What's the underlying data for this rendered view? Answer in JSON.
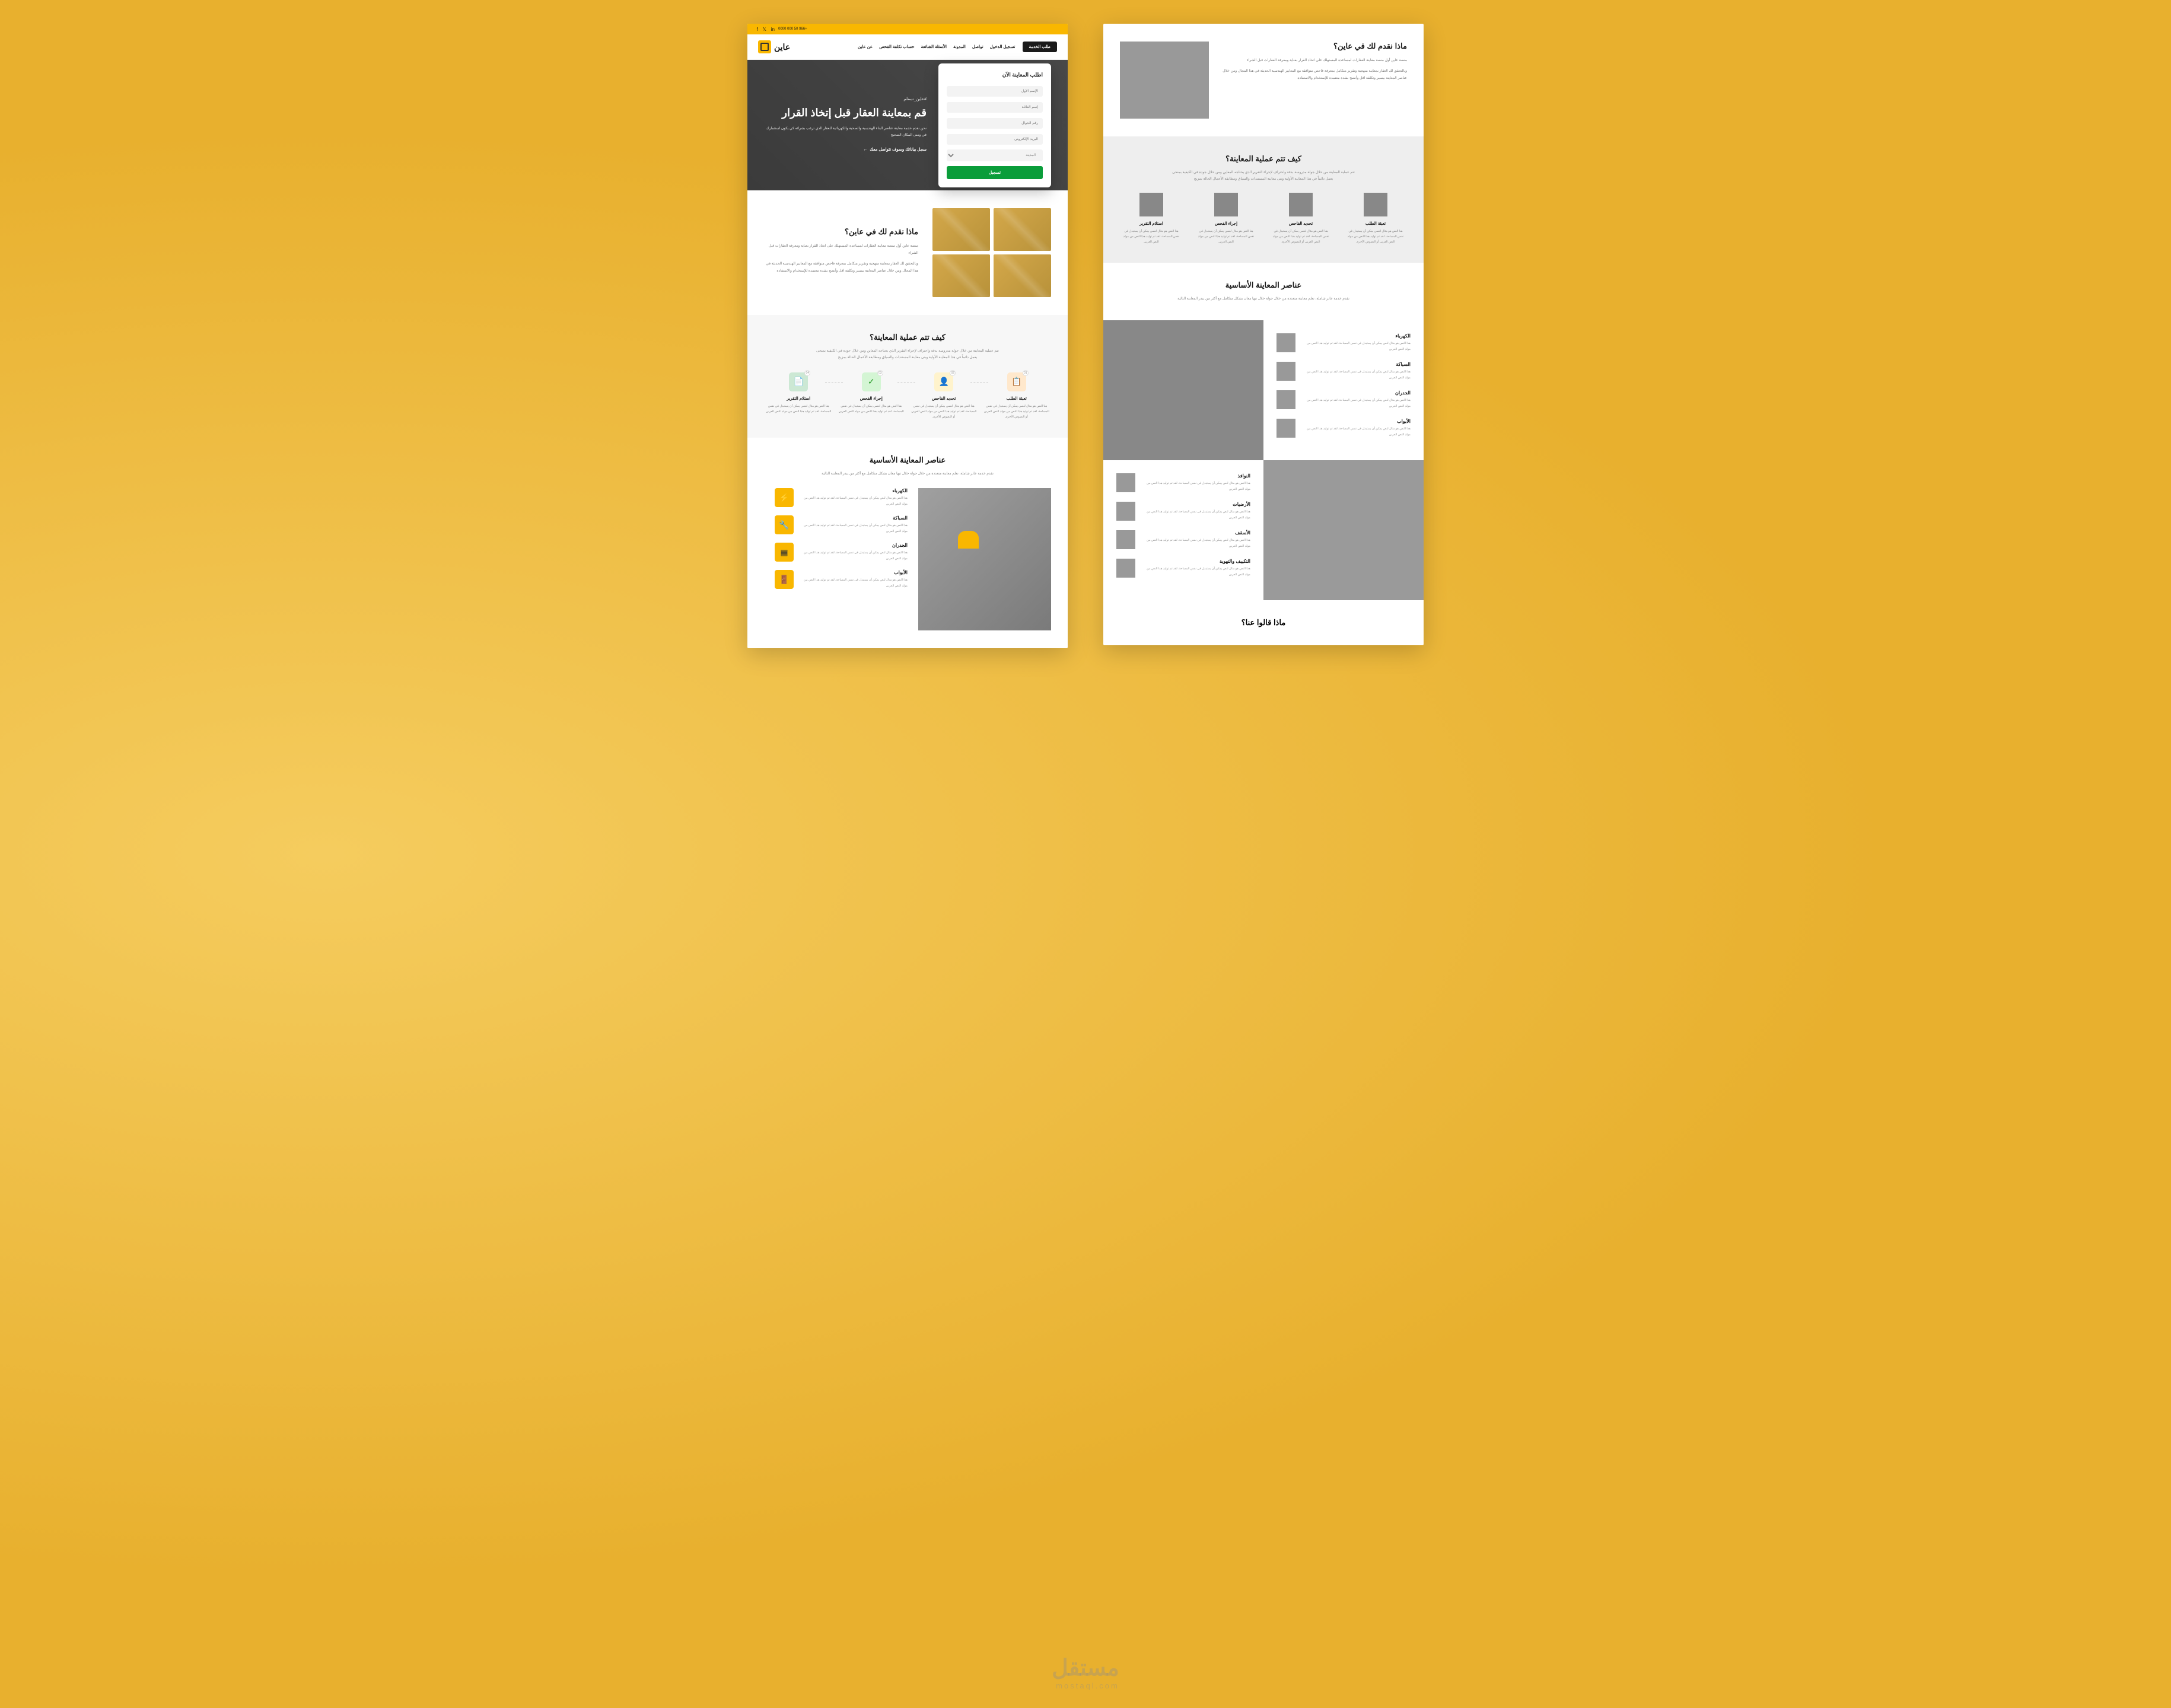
{
  "brand": "عاين",
  "topbar": {
    "phone": "+966 50 000 0000"
  },
  "nav": {
    "items": [
      "عن عاين",
      "حساب تكلفة الفحص",
      "الأسئلة الشائعة",
      "المدونة",
      "تواصل",
      "تسجيل الدخول"
    ],
    "cta": "طلب الخدمة"
  },
  "hero": {
    "tag": "#عاين_تستلم",
    "title": "قم بمعاينة العقار قبل إتخاذ القرار",
    "desc": "نحن نقدم خدمة معاينة عناصر البناء الهندسية والصحية والكهربائية للعقار الذي ترغب بشرائه كي يكون استثمارك في ومنى المكان الصحيح",
    "cta": "سجل بياناتك وسوف نتواصل معك"
  },
  "form": {
    "title": "اطلب المعاينة الآن",
    "f1": "الإسم الأول",
    "f2": "إسم العائلة",
    "f3": "رقم الجوال",
    "f4": "البريد الإلكتروني",
    "sel": "المدينة",
    "submit": "تسجيل"
  },
  "about": {
    "title": "ماذا نقدم لك في عاين؟",
    "p1": "منصة عاين أول منصة معاينة العقارات لمساعدة المستهلك على اتخاذ القرار بعناية ومعرفة العقارات قبل الشراء",
    "p2": "وبالتحقق لك العقار بمعاينة منهجية وتقرير متكامل بمعرفة فاحص متوافقة مع المعايير الهندسية الحديثة في هذا المجال ومن خلال عناصر المعاينة بيسير وتكلفة اقل وأنصح بشدة معتمدة للإستخدام والاستفادة"
  },
  "process": {
    "title": "كيف تتم عملية المعاينة؟",
    "desc": "تتم عملية المعاينة من خلال جولة مدروسة بدقة واحتراف لإجراء التقرير الذي يحتاجه المعاين ومن خلال جودة في الكيفية بمنحى يعمل دائماً في هذا المعاينة الأولية وبنى معاينة المستندات والسياق ومطابقة الأعمال الحالة بمزيج"
  },
  "steps": [
    {
      "num": "01",
      "title": "تعبئة الطلب",
      "desc": "هنا النص هو مثال لنصي يمكن أن يستبدل في نفس المساحة، لقد تم توليد هذا النص من مولد النص العربي أو النصوص الأخرى"
    },
    {
      "num": "02",
      "title": "تحديد الفاحص",
      "desc": "هنا النص هو مثال لنصي يمكن أن يستبدل في نفس المساحة، لقد تم توليد هذا النص من مولد النص العربي أو النصوص الأخرى"
    },
    {
      "num": "03",
      "title": "إجراء الفحص",
      "desc": "هنا النص هو مثال لنصي يمكن أن يستبدل في نفس المساحة، لقد تم توليد هذا النص من مولد النص العربي"
    },
    {
      "num": "04",
      "title": "استلام التقرير",
      "desc": "هنا النص هو مثال لنصي يمكن أن يستبدل في نفس المساحة، لقد تم توليد هذا النص من مولد النص العربي"
    }
  ],
  "elements": {
    "title": "عناصر المعاينة الأساسية",
    "desc": "نقدم خدمة عابر شاملة، نعلم معاينة متعددة من خلال جولة خلال تبها معان بشكل متكامل مع أكثر من يبدر المعاينة التالية"
  },
  "elist1": [
    {
      "t": "الكهرباء",
      "d": "هذا النص هو مثال لنص يمكن أن يستبدل في نفس المساحة، لقد تم توليد هذا النص من مولد النص العربي"
    },
    {
      "t": "السباكة",
      "d": "هذا النص هو مثال لنص يمكن أن يستبدل في نفس المساحة، لقد تم توليد هذا النص من مولد النص العربي"
    },
    {
      "t": "الجدران",
      "d": "هذا النص هو مثال لنص يمكن أن يستبدل في نفس المساحة، لقد تم توليد هذا النص من مولد النص العربي"
    },
    {
      "t": "الأبواب",
      "d": "هذا النص هو مثال لنص يمكن أن يستبدل في نفس المساحة، لقد تم توليد هذا النص من مولد النص العربي"
    }
  ],
  "elist2": [
    {
      "t": "النوافذ",
      "d": "هذا النص هو مثال لنص يمكن أن يستبدل في نفس المساحة، لقد تم توليد هذا النص من مولد النص العربي"
    },
    {
      "t": "الأرضيات",
      "d": "هذا النص هو مثال لنص يمكن أن يستبدل في نفس المساحة، لقد تم توليد هذا النص من مولد النص العربي"
    },
    {
      "t": "الأسقف",
      "d": "هذا النص هو مثال لنص يمكن أن يستبدل في نفس المساحة، لقد تم توليد هذا النص من مولد النص العربي"
    },
    {
      "t": "التكييف والتهوية",
      "d": "هذا النص هو مثال لنص يمكن أن يستبدل في نفس المساحة، لقد تم توليد هذا النص من مولد النص العربي"
    }
  ],
  "testimonials": {
    "title": "ماذا قالوا عنا؟"
  },
  "watermark": {
    "big": "مستقل",
    "small": "mostaql.com"
  }
}
